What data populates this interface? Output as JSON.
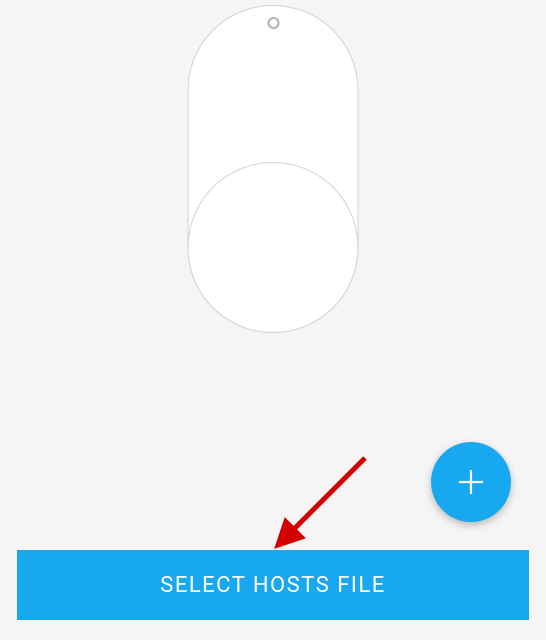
{
  "toggle": {
    "state": "off"
  },
  "fab": {
    "label": "+",
    "purpose": "add"
  },
  "select_button": {
    "label": "SELECT HOSTS FILE"
  },
  "annotation": {
    "kind": "arrow",
    "color": "#d40000",
    "points_to": "select-hosts-file-button"
  }
}
